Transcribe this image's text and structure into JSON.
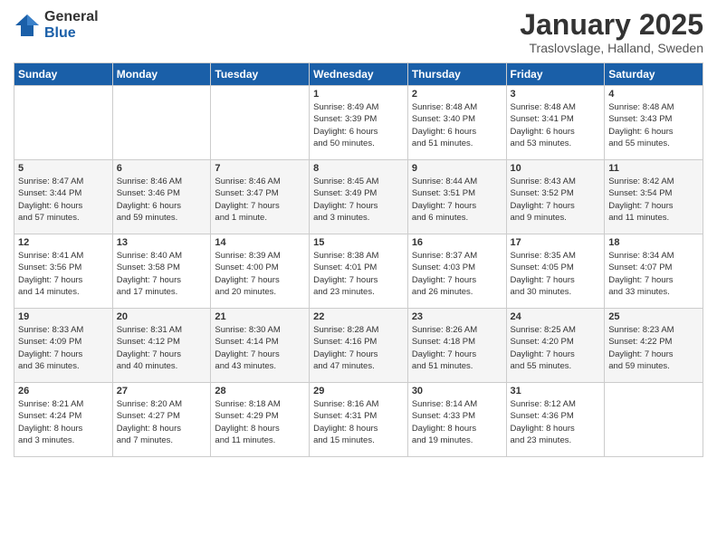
{
  "header": {
    "logo_general": "General",
    "logo_blue": "Blue",
    "month_title": "January 2025",
    "location": "Traslovslage, Halland, Sweden"
  },
  "days_of_week": [
    "Sunday",
    "Monday",
    "Tuesday",
    "Wednesday",
    "Thursday",
    "Friday",
    "Saturday"
  ],
  "weeks": [
    [
      {
        "day": "",
        "info": ""
      },
      {
        "day": "",
        "info": ""
      },
      {
        "day": "",
        "info": ""
      },
      {
        "day": "1",
        "info": "Sunrise: 8:49 AM\nSunset: 3:39 PM\nDaylight: 6 hours\nand 50 minutes."
      },
      {
        "day": "2",
        "info": "Sunrise: 8:48 AM\nSunset: 3:40 PM\nDaylight: 6 hours\nand 51 minutes."
      },
      {
        "day": "3",
        "info": "Sunrise: 8:48 AM\nSunset: 3:41 PM\nDaylight: 6 hours\nand 53 minutes."
      },
      {
        "day": "4",
        "info": "Sunrise: 8:48 AM\nSunset: 3:43 PM\nDaylight: 6 hours\nand 55 minutes."
      }
    ],
    [
      {
        "day": "5",
        "info": "Sunrise: 8:47 AM\nSunset: 3:44 PM\nDaylight: 6 hours\nand 57 minutes."
      },
      {
        "day": "6",
        "info": "Sunrise: 8:46 AM\nSunset: 3:46 PM\nDaylight: 6 hours\nand 59 minutes."
      },
      {
        "day": "7",
        "info": "Sunrise: 8:46 AM\nSunset: 3:47 PM\nDaylight: 7 hours\nand 1 minute."
      },
      {
        "day": "8",
        "info": "Sunrise: 8:45 AM\nSunset: 3:49 PM\nDaylight: 7 hours\nand 3 minutes."
      },
      {
        "day": "9",
        "info": "Sunrise: 8:44 AM\nSunset: 3:51 PM\nDaylight: 7 hours\nand 6 minutes."
      },
      {
        "day": "10",
        "info": "Sunrise: 8:43 AM\nSunset: 3:52 PM\nDaylight: 7 hours\nand 9 minutes."
      },
      {
        "day": "11",
        "info": "Sunrise: 8:42 AM\nSunset: 3:54 PM\nDaylight: 7 hours\nand 11 minutes."
      }
    ],
    [
      {
        "day": "12",
        "info": "Sunrise: 8:41 AM\nSunset: 3:56 PM\nDaylight: 7 hours\nand 14 minutes."
      },
      {
        "day": "13",
        "info": "Sunrise: 8:40 AM\nSunset: 3:58 PM\nDaylight: 7 hours\nand 17 minutes."
      },
      {
        "day": "14",
        "info": "Sunrise: 8:39 AM\nSunset: 4:00 PM\nDaylight: 7 hours\nand 20 minutes."
      },
      {
        "day": "15",
        "info": "Sunrise: 8:38 AM\nSunset: 4:01 PM\nDaylight: 7 hours\nand 23 minutes."
      },
      {
        "day": "16",
        "info": "Sunrise: 8:37 AM\nSunset: 4:03 PM\nDaylight: 7 hours\nand 26 minutes."
      },
      {
        "day": "17",
        "info": "Sunrise: 8:35 AM\nSunset: 4:05 PM\nDaylight: 7 hours\nand 30 minutes."
      },
      {
        "day": "18",
        "info": "Sunrise: 8:34 AM\nSunset: 4:07 PM\nDaylight: 7 hours\nand 33 minutes."
      }
    ],
    [
      {
        "day": "19",
        "info": "Sunrise: 8:33 AM\nSunset: 4:09 PM\nDaylight: 7 hours\nand 36 minutes."
      },
      {
        "day": "20",
        "info": "Sunrise: 8:31 AM\nSunset: 4:12 PM\nDaylight: 7 hours\nand 40 minutes."
      },
      {
        "day": "21",
        "info": "Sunrise: 8:30 AM\nSunset: 4:14 PM\nDaylight: 7 hours\nand 43 minutes."
      },
      {
        "day": "22",
        "info": "Sunrise: 8:28 AM\nSunset: 4:16 PM\nDaylight: 7 hours\nand 47 minutes."
      },
      {
        "day": "23",
        "info": "Sunrise: 8:26 AM\nSunset: 4:18 PM\nDaylight: 7 hours\nand 51 minutes."
      },
      {
        "day": "24",
        "info": "Sunrise: 8:25 AM\nSunset: 4:20 PM\nDaylight: 7 hours\nand 55 minutes."
      },
      {
        "day": "25",
        "info": "Sunrise: 8:23 AM\nSunset: 4:22 PM\nDaylight: 7 hours\nand 59 minutes."
      }
    ],
    [
      {
        "day": "26",
        "info": "Sunrise: 8:21 AM\nSunset: 4:24 PM\nDaylight: 8 hours\nand 3 minutes."
      },
      {
        "day": "27",
        "info": "Sunrise: 8:20 AM\nSunset: 4:27 PM\nDaylight: 8 hours\nand 7 minutes."
      },
      {
        "day": "28",
        "info": "Sunrise: 8:18 AM\nSunset: 4:29 PM\nDaylight: 8 hours\nand 11 minutes."
      },
      {
        "day": "29",
        "info": "Sunrise: 8:16 AM\nSunset: 4:31 PM\nDaylight: 8 hours\nand 15 minutes."
      },
      {
        "day": "30",
        "info": "Sunrise: 8:14 AM\nSunset: 4:33 PM\nDaylight: 8 hours\nand 19 minutes."
      },
      {
        "day": "31",
        "info": "Sunrise: 8:12 AM\nSunset: 4:36 PM\nDaylight: 8 hours\nand 23 minutes."
      },
      {
        "day": "",
        "info": ""
      }
    ]
  ]
}
